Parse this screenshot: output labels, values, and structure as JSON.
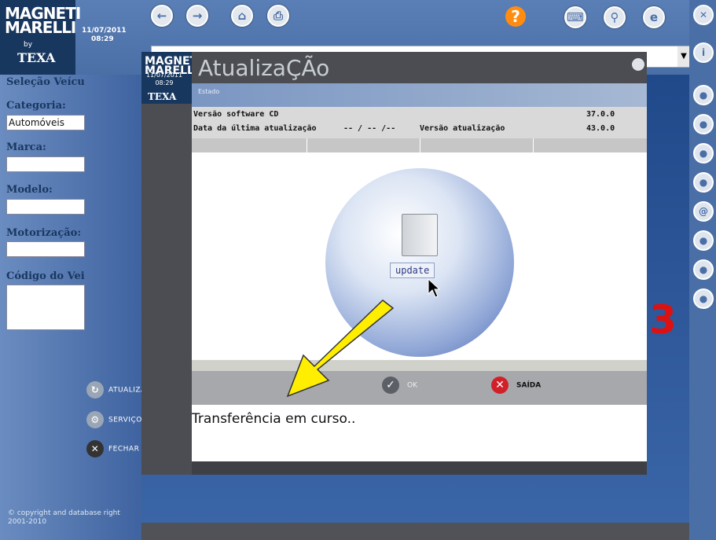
{
  "app": {
    "brand_top": "MAGNETI\nMARELLI",
    "brand_by": "by",
    "brand_texa": "TEXA",
    "date": "11/07/2011",
    "time": "08:29"
  },
  "nav_icons": [
    "back-icon",
    "forward-icon",
    "home-icon",
    "print-icon"
  ],
  "help_label": "?",
  "left_panel": {
    "title": "Seleção Veícu",
    "fields": [
      {
        "label": "Categoria:",
        "value": "Automóveis"
      },
      {
        "label": "Marca:",
        "value": ""
      },
      {
        "label": "Modelo:",
        "value": ""
      },
      {
        "label": "Motorização:",
        "value": ""
      },
      {
        "label": "Código do Vei",
        "value": ""
      }
    ],
    "copyright": "© copyright and database right 2001-2010"
  },
  "side_buttons": [
    {
      "label": "ATUALIZAR"
    },
    {
      "label": "SERVIÇO"
    },
    {
      "label": "FECHAR"
    }
  ],
  "dialog": {
    "title": "AtualizaÇÃo",
    "subtitle": "Estado",
    "info": {
      "sw_label": "Versão software CD",
      "sw_value": "37.0.0",
      "date_label": "Data da última atualização",
      "date_value": "-- / -- /--",
      "ver_label": "Versão atualização",
      "ver_value": "43.0.0"
    },
    "update_label": "update",
    "ok_label": "OK",
    "exit_label": "SAÍDA",
    "message": "Transferência em curso.."
  },
  "colors": {
    "arrow": "#ffee00",
    "brand_blue": "#18375f",
    "exit_red": "#d1202a",
    "help_orange": "#ff8c10"
  }
}
